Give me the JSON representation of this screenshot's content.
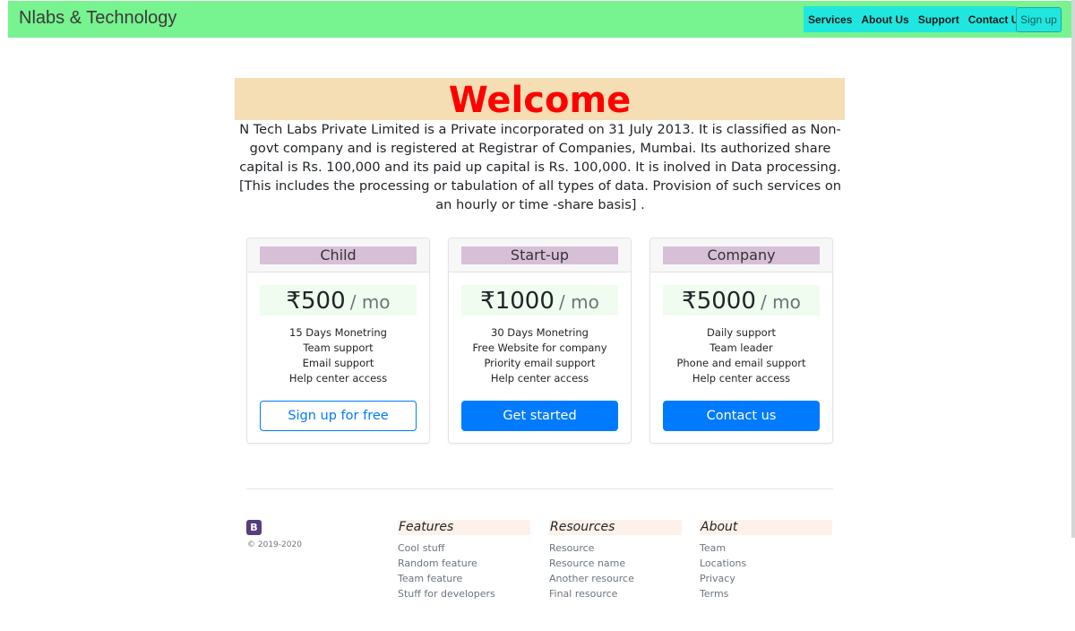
{
  "navbar": {
    "brand": "Nlabs & Technology",
    "links": [
      "Services",
      "About Us",
      "Support",
      "Contact Us"
    ],
    "signup": "Sign up"
  },
  "hero": {
    "title": "Welcome",
    "intro": "N Tech Labs Private Limited is a Private incorporated on 31 July 2013. It is classified as Non-govt company and is registered at Registrar of Companies, Mumbai. Its authorized share capital is Rs. 100,000 and its paid up capital is Rs. 100,000. It is inolved in Data processing. [This includes the processing or tabulation of all types of data. Provision of such services on an hourly or time -share basis] ."
  },
  "plans": [
    {
      "name": "Child",
      "price": "₹500",
      "period": "/ mo",
      "features": [
        "15 Days Monetring",
        "Team support",
        "Email support",
        "Help center access"
      ],
      "cta": "Sign up for free"
    },
    {
      "name": "Start-up",
      "price": "₹1000",
      "period": "/ mo",
      "features": [
        "30 Days Monetring",
        "Free Website for company",
        "Priority email support",
        "Help center access"
      ],
      "cta": "Get started"
    },
    {
      "name": "Company",
      "price": "₹5000",
      "period": "/ mo",
      "features": [
        "Daily support",
        "Team leader",
        "Phone and email support",
        "Help center access"
      ],
      "cta": "Contact us"
    }
  ],
  "footer": {
    "logo": "B",
    "copyright": "© 2019-2020",
    "columns": [
      {
        "title": "Features",
        "links": [
          "Cool stuff",
          "Random feature",
          "Team feature",
          "Stuff for developers"
        ]
      },
      {
        "title": "Resources",
        "links": [
          "Resource",
          "Resource name",
          "Another resource",
          "Final resource"
        ]
      },
      {
        "title": "About",
        "links": [
          "Team",
          "Locations",
          "Privacy",
          "Terms"
        ]
      }
    ]
  },
  "colors": {
    "navbar_bg": "#77f38f",
    "nav_links_bg": "#1fe7e0",
    "welcome_bg": "#f5deb3",
    "welcome_text": "#ff0000",
    "plan_name_bg": "#d8bfd8",
    "price_bg": "#effcef",
    "primary": "#007bff",
    "footer_heading_bg": "#fdf1ea",
    "logo_bg": "#563d7c"
  }
}
